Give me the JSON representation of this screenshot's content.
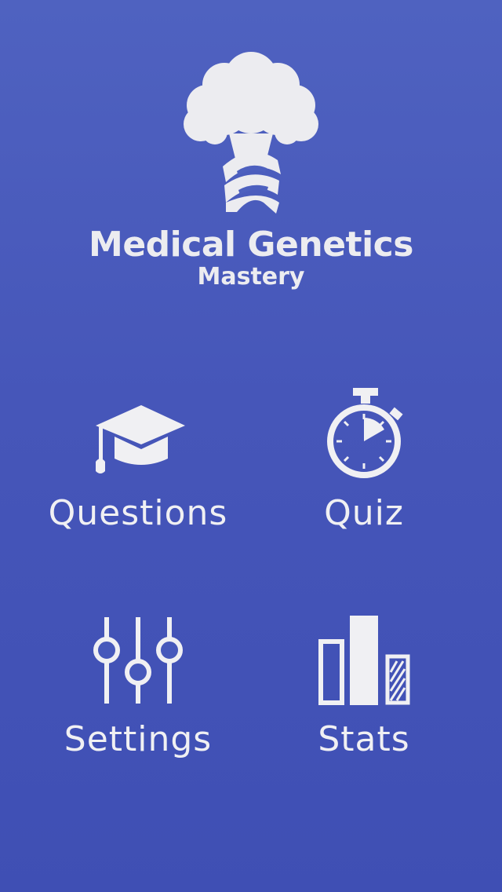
{
  "app": {
    "title": "Medical Genetics",
    "subtitle": "Mastery",
    "logo_icon": "tree-dna-helix-icon"
  },
  "menu": {
    "items": [
      {
        "label": "Questions",
        "icon": "graduation-cap-icon"
      },
      {
        "label": "Quiz",
        "icon": "stopwatch-icon"
      },
      {
        "label": "Settings",
        "icon": "sliders-icon"
      },
      {
        "label": "Stats",
        "icon": "bar-chart-icon"
      }
    ]
  },
  "colors": {
    "background_top": "#4f62c0",
    "background_bottom": "#3f4fb4",
    "foreground": "#f0f0f3"
  }
}
